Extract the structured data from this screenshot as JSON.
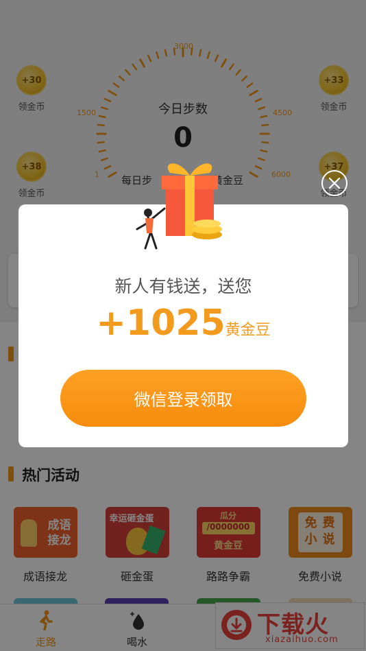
{
  "gauge": {
    "tick_labels": [
      "1",
      "1500",
      "3000",
      "4500",
      "6000"
    ],
    "title": "今日步数",
    "steps": "0",
    "daily_left": "每日步",
    "daily_right": "黄金豆"
  },
  "coins": [
    {
      "value": "+30",
      "label": "领金币"
    },
    {
      "value": "+33",
      "label": "领金币"
    },
    {
      "value": "+38",
      "label": "领金币"
    },
    {
      "value": "+37",
      "label": "领金币"
    }
  ],
  "hot": {
    "title": "热门活动",
    "items": [
      {
        "name": "成语接龙",
        "thumb": "成语\n接龙",
        "color": "#f2622e"
      },
      {
        "name": "砸金蛋",
        "thumb": "幸运砸金蛋",
        "color": "#d8403a"
      },
      {
        "name": "路路争霸",
        "thumb": "瓜分 /0000000 黄金豆",
        "color": "#e23a35"
      },
      {
        "name": "免费小说",
        "thumb": "免费 小说",
        "color": "#f08c1c"
      }
    ]
  },
  "tabs": [
    {
      "label": "走路",
      "icon": "walk-icon"
    },
    {
      "label": "喝水",
      "icon": "water-drop-icon"
    }
  ],
  "watermark": {
    "title": "下载火",
    "sub": "xiazaihuo.com"
  },
  "modal": {
    "message": "新人有钱送，送您",
    "amount": "+1025",
    "unit": "黄金豆",
    "button": "微信登录领取"
  },
  "colors": {
    "accent": "#f29a1e",
    "brand_red": "#e8423b"
  }
}
